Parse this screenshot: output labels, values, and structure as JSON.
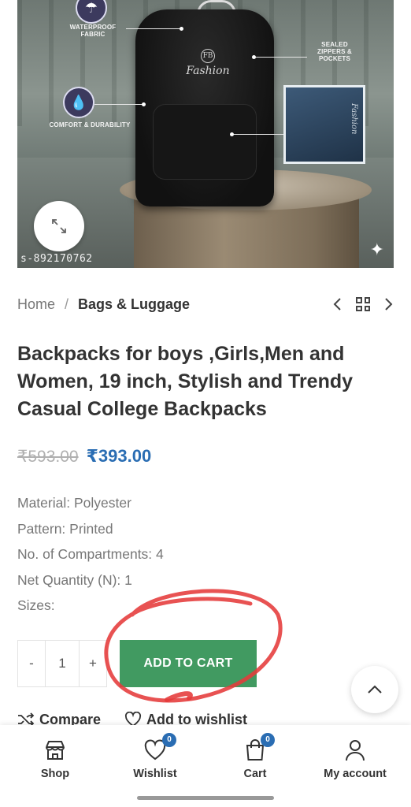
{
  "product_image": {
    "code": "s-892170762",
    "callouts": {
      "waterproof": "WATERPROOF FABRIC",
      "comfort": "COMFORT & DURABILITY",
      "sealed": "SEALED ZIPPERS & POCKETS"
    },
    "brand_text": "Fashion",
    "brand_mark": "FB",
    "inset_text": "Fashion"
  },
  "breadcrumb": {
    "home": "Home",
    "separator": "/",
    "current": "Bags & Luggage"
  },
  "product": {
    "title": "Backpacks for boys ,Girls,Men and Women, 19 inch, Stylish and Trendy Casual College Backpacks",
    "old_price": "₹593.00",
    "price": "₹393.00",
    "specs": [
      "Material: Polyester",
      "Pattern: Printed",
      "No. of Compartments: 4",
      "Net Quantity (N): 1",
      "Sizes:"
    ]
  },
  "quantity": {
    "minus": "-",
    "value": "1",
    "plus": "+"
  },
  "add_to_cart_label": "ADD TO CART",
  "actions": {
    "compare": "Compare",
    "wishlist": "Add to wishlist"
  },
  "bottom_nav": {
    "shop": "Shop",
    "wishlist": "Wishlist",
    "wishlist_count": "0",
    "cart": "Cart",
    "cart_count": "0",
    "account": "My account"
  },
  "colors": {
    "accent_blue": "#2a6db3",
    "cart_green": "#419a61",
    "annotation_red": "#e53a3a"
  }
}
